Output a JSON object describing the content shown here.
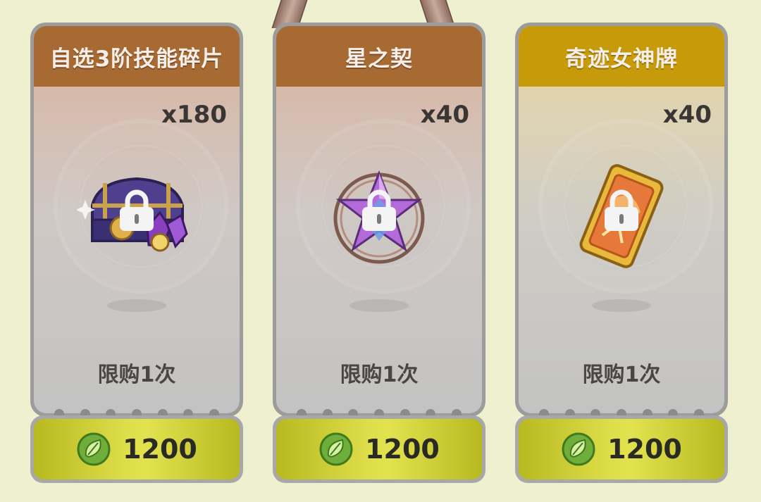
{
  "colors": {
    "title_brown": "#a86a33",
    "title_gold": "#c79a09",
    "price_green": "#d7d740"
  },
  "cards": [
    {
      "title": "自选3阶技能碎片",
      "quantity": "x180",
      "limit": "限购1次",
      "price": "1200",
      "item_icon": "skill-fragment-chest-icon",
      "currency_icon": "green-leaf-coin-icon",
      "locked": true
    },
    {
      "title": "星之契",
      "quantity": "x40",
      "limit": "限购1次",
      "price": "1200",
      "item_icon": "star-contract-crystal-icon",
      "currency_icon": "green-leaf-coin-icon",
      "locked": true
    },
    {
      "title": "奇迹女神牌",
      "quantity": "x40",
      "limit": "限购1次",
      "price": "1200",
      "item_icon": "miracle-goddess-card-icon",
      "currency_icon": "green-leaf-coin-icon",
      "locked": true
    }
  ]
}
